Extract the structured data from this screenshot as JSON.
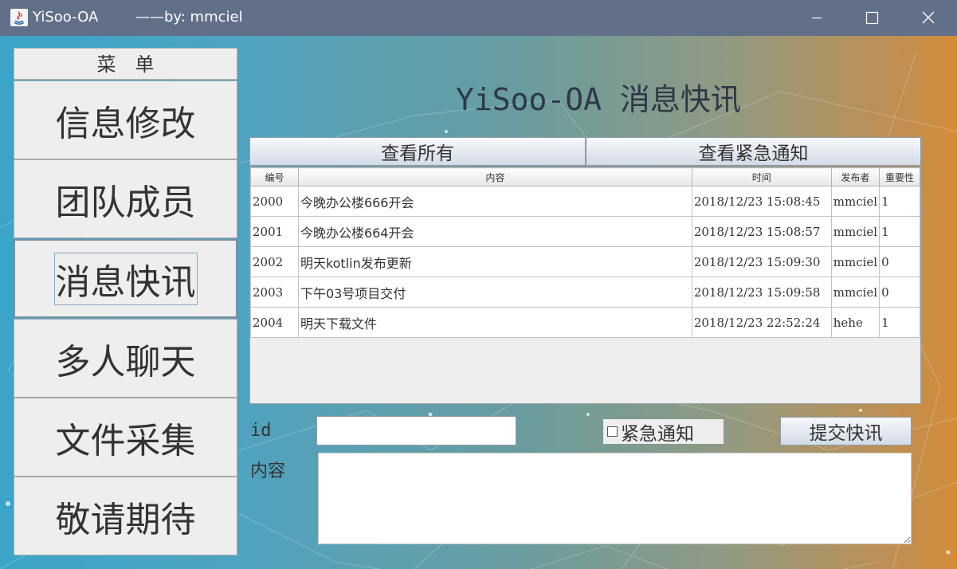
{
  "window": {
    "title": "YiSoo-OA",
    "author": "——by: mmciel",
    "controls": [
      "minimize-icon",
      "maximize-icon",
      "close-icon"
    ]
  },
  "sidebar": {
    "header": "菜单",
    "items": [
      {
        "label": "信息修改"
      },
      {
        "label": "团队成员"
      },
      {
        "label": "消息快讯",
        "active": true
      },
      {
        "label": "多人聊天"
      },
      {
        "label": "文件采集"
      },
      {
        "label": "敬请期待"
      }
    ]
  },
  "main": {
    "title": "YiSoo-OA 消息快讯",
    "tabs": [
      {
        "label": "查看所有"
      },
      {
        "label": "查看紧急通知"
      }
    ],
    "table": {
      "columns": [
        "编号",
        "内容",
        "时间",
        "发布者",
        "重要性"
      ],
      "rows": [
        {
          "id": "2000",
          "content": "今晚办公楼666开会",
          "time": "2018/12/23 15:08:45",
          "publisher": "mmciel",
          "importance": "1"
        },
        {
          "id": "2001",
          "content": "今晚办公楼664开会",
          "time": "2018/12/23 15:08:57",
          "publisher": "mmciel",
          "importance": "1"
        },
        {
          "id": "2002",
          "content": "明天kotlin发布更新",
          "time": "2018/12/23 15:09:30",
          "publisher": "mmciel",
          "importance": "0"
        },
        {
          "id": "2003",
          "content": "下午03号项目交付",
          "time": "2018/12/23 15:09:58",
          "publisher": "mmciel",
          "importance": "0"
        },
        {
          "id": "2004",
          "content": "明天下载文件",
          "time": "2018/12/23 22:52:24",
          "publisher": "hehe",
          "importance": "1"
        }
      ]
    },
    "form": {
      "id_label": "id",
      "id_value": "",
      "urgent_label": "紧急通知",
      "urgent_checked": false,
      "submit_label": "提交快讯",
      "content_label": "内容",
      "content_value": ""
    }
  },
  "colors": {
    "titlebar": "#616f89",
    "gradient_left": "#3aa5c9",
    "gradient_right": "#d58c38"
  }
}
